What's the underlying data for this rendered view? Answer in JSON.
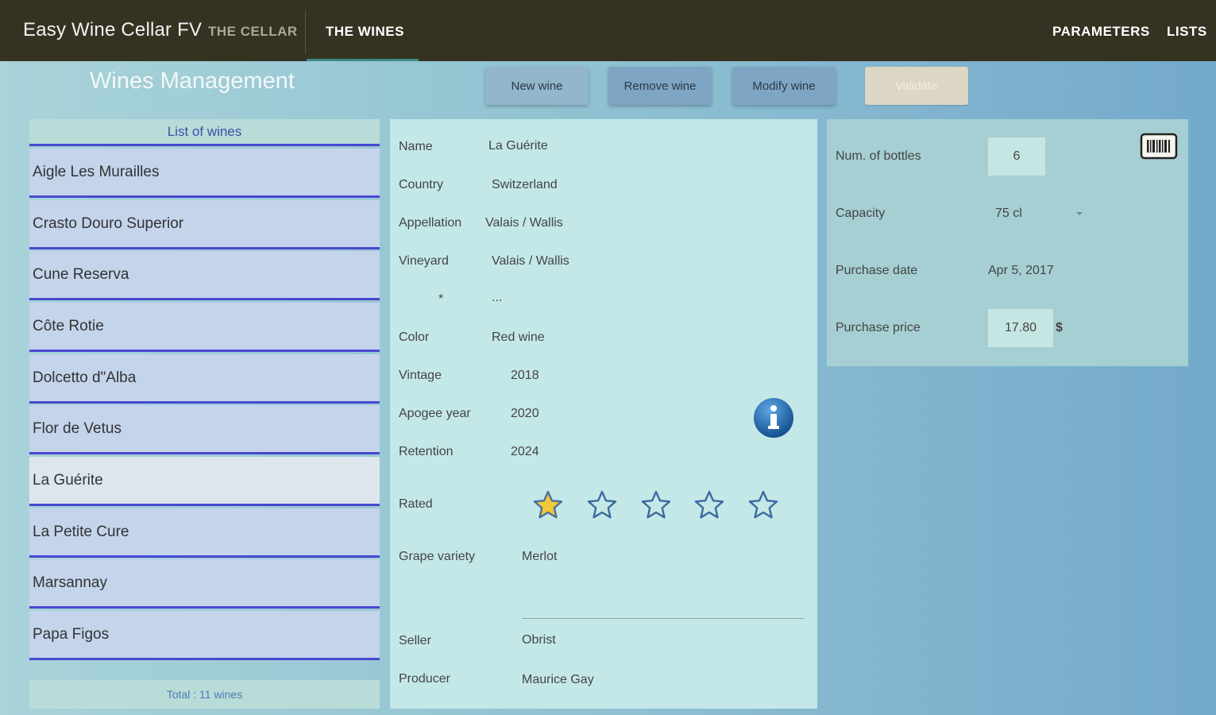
{
  "app": {
    "title": "Easy Wine Cellar FV",
    "tabs": {
      "cellar": "THE CELLAR",
      "wines": "THE WINES",
      "parameters": "PARAMETERS",
      "lists": "LISTS"
    }
  },
  "page_heading": "Wines Management",
  "toolbar": {
    "new_wine": "New wine",
    "remove_wine": "Remove wine",
    "modify_wine": "Modify wine",
    "validate": "Validate"
  },
  "wine_list": {
    "header": "List of wines",
    "items": [
      "Aigle Les Murailles",
      "Crasto Douro Superior",
      "Cune Reserva",
      "Côte Rotie",
      "Dolcetto d\"Alba",
      "Flor de Vetus",
      "La Guérite",
      "La Petite Cure",
      "Marsannay",
      "Papa Figos"
    ],
    "selected": "La Guérite",
    "footer": "Total : 11 wines"
  },
  "details": {
    "name_label": "Name",
    "name_value": "La Guérite",
    "country_label": "Country",
    "country_value": "Switzerland",
    "appellation_label": "Appellation",
    "appellation_value": "Valais / Wallis",
    "vineyard_label": "Vineyard",
    "vineyard_value": "Valais / Wallis",
    "extra_label": "*",
    "extra_value": "...",
    "color_label": "Color",
    "color_value": "Red wine",
    "vintage_label": "Vintage",
    "vintage_value": "2018",
    "apogee_label": "Apogee year",
    "apogee_value": "2020",
    "retention_label": "Retention",
    "retention_value": "2024",
    "rated_label": "Rated",
    "rating": 1,
    "rating_max": 5,
    "grape_label": "Grape variety",
    "grape_value": "Merlot",
    "seller_label": "Seller",
    "seller_value": "Obrist",
    "producer_label": "Producer",
    "producer_value": "Maurice Gay"
  },
  "stock": {
    "bottles_label": "Num. of bottles",
    "bottles_value": "6",
    "capacity_label": "Capacity",
    "capacity_value": "75 cl",
    "purchase_date_label": "Purchase date",
    "purchase_date_value": "Apr 5, 2017",
    "purchase_price_label": "Purchase price",
    "purchase_price_value": "17.80",
    "currency": "$"
  },
  "colors": {
    "topbar": "#363222",
    "list_divider": "#4848d0",
    "star_filled": "#f0c93a"
  }
}
